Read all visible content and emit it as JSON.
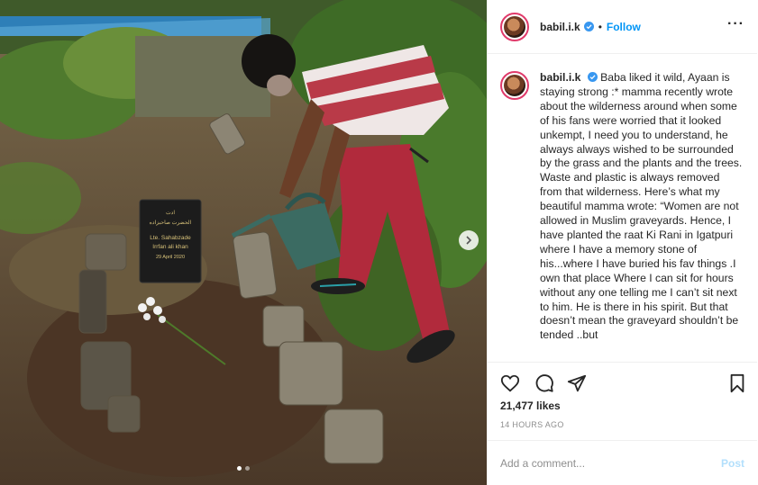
{
  "post": {
    "username": "babil.i.k",
    "separator": "•",
    "follow_label": "Follow",
    "more_icon": "more-horizontal-icon",
    "caption": "Baba liked it wild, Ayaan is staying strong :* mamma recently wrote about the wilderness around when some of his fans were worried that it looked unkempt, I need you to understand, he always always wished to be surrounded by the grass and the plants and the trees. Waste and plastic is always removed from that wilderness. Here’s what my beautiful mamma wrote: “Women are not allowed in Muslim graveyards. Hence, I have planted the raat Ki Rani in Igatpuri where I have a memory stone of his...where I have buried his fav things .I own that place Where I can sit for hours without any one telling me I can’t sit next to him. He is there in his spirit. But that doesn’t mean the graveyard shouldn’t be tended ..but",
    "likes": "21,477 likes",
    "timestamp": "14 HOURS AGO",
    "comment_placeholder": "Add a comment...",
    "post_label": "Post",
    "carousel": {
      "total": 2,
      "active": 0
    }
  },
  "gravestone": {
    "line1": "ادت",
    "line2": "الحضرت صاحبزاده",
    "line3": "Lte. Sahabzade",
    "line4": "Irrfan ali khan",
    "line5": "29 April 2020"
  },
  "colors": {
    "link_blue": "#0095f6",
    "post_disabled": "#b2dffc",
    "text": "#262626",
    "muted": "#8e8e8e",
    "divider": "#efefef",
    "verified_blue": "#3897f0"
  },
  "icons": [
    "heart-icon",
    "comment-icon",
    "share-icon",
    "bookmark-icon",
    "verified-badge-icon",
    "chevron-right-icon"
  ]
}
